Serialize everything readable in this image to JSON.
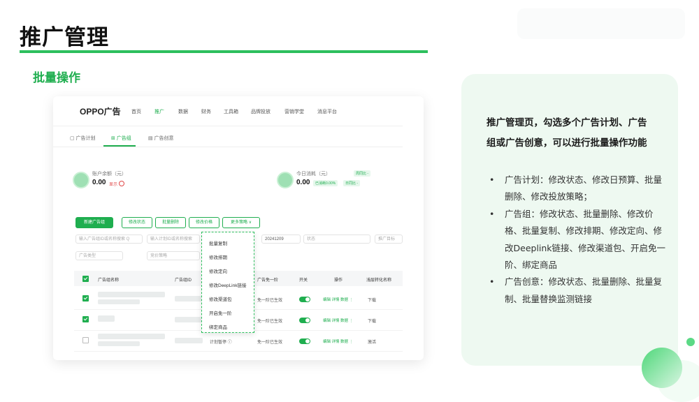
{
  "page": {
    "title": "推广管理",
    "section_title": "批量操作"
  },
  "screenshot": {
    "logo": "OPPO广告",
    "nav": [
      "首页",
      "推广",
      "数据",
      "财务",
      "工具箱",
      "品牌投放",
      "营销学堂",
      "消息平台"
    ],
    "nav_active_index": 1,
    "subtabs": [
      "广告计划",
      "广告组",
      "广告创意"
    ],
    "subtab_active_index": 1,
    "balance": {
      "label": "账户余额（元）",
      "value": "0.00",
      "note": "显示"
    },
    "spend": {
      "label": "今日消耗（元）",
      "value": "0.00",
      "chip_compare": "周同比 -",
      "chip_consume": "已消耗0.00%",
      "chip_day": "日同比 -"
    },
    "toolbar": {
      "new_group": "新建广告组",
      "edit_status": "修改状态",
      "batch_delete": "批量删除",
      "edit_price": "修改价格",
      "more": "更多策略 ∨"
    },
    "filters": {
      "group_search": "输入广告组ID或名称搜索 Q",
      "plan_search": "输入计划ID或名称搜索",
      "date": "20241209",
      "status": "状态",
      "target": "推广目标",
      "type": "广告类型",
      "strategy": "竞价策略"
    },
    "table": {
      "headers": [
        "广告组名称",
        "广告组ID",
        "广告免一阶",
        "开关",
        "操作",
        "浅层转化名称"
      ],
      "rows": [
        {
          "checked": true,
          "exempt": "免一阶已生效",
          "ops": "编辑 详情 数据 ⋮",
          "conversion": "下载"
        },
        {
          "checked": true,
          "exempt": "免一阶已生效",
          "ops": "编辑 详情 数据 ⋮",
          "conversion": "下载"
        },
        {
          "checked": false,
          "status": "计划暂停 ⓘ",
          "exempt": "免一阶已生效",
          "ops": "编辑 详情 数据 ⋮",
          "conversion": "激活"
        }
      ]
    },
    "dropdown": [
      "批量复制",
      "修改排期",
      "修改定向",
      "修改DeepLink链接",
      "修改渠道包",
      "开启免一阶",
      "绑定商品"
    ]
  },
  "panel": {
    "intro": "推广管理页，勾选多个广告计划、广告组或广告创意，可以进行批量操作功能",
    "bullets": [
      "广告计划：修改状态、修改日预算、批量删除、修改投放策略；",
      "广告组：修改状态、批量删除、修改价格、批量复制、修改排期、修改定向、修改Deeplink链接、修改渠道包、开启免一阶、绑定商品",
      "广告创意：修改状态、批量删除、批量复制、批量替换监测链接"
    ]
  },
  "colors": {
    "accent": "#2dbf5d",
    "accent_dark": "#1fae4f",
    "panel_bg": "#eef9f1"
  }
}
